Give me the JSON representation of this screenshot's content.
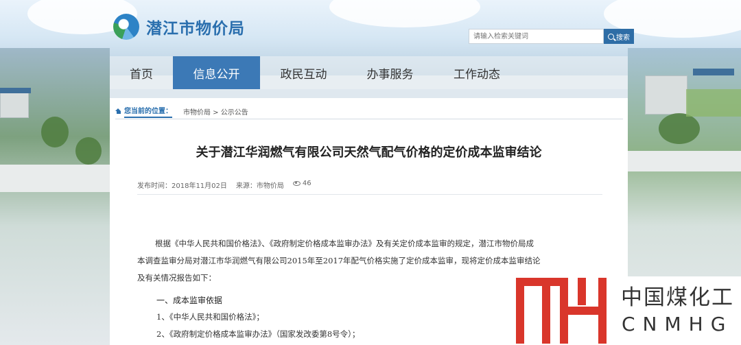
{
  "site": {
    "name": "潜江市物价局"
  },
  "search": {
    "placeholder": "请输入检索关键词",
    "button_label": "搜索"
  },
  "nav": {
    "items": [
      {
        "label": "首页",
        "active": false
      },
      {
        "label": "信息公开",
        "active": true
      },
      {
        "label": "政民互动",
        "active": false
      },
      {
        "label": "办事服务",
        "active": false
      },
      {
        "label": "工作动态",
        "active": false
      }
    ]
  },
  "breadcrumb": {
    "label": "您当前的位置：",
    "path": "市物价局 > 公示公告"
  },
  "article": {
    "title": "关于潜江华润燃气有限公司天然气配气价格的定价成本监审结论",
    "publish_time": "发布时间：2018年11月02日",
    "source": "来源：市物价局",
    "views": "46",
    "paragraph_lines": [
      "根据《中华人民共和国价格法》、《政府制定价格成本监审办法》及有关定价成本监审的规定，潜江市物价局成",
      "本调查监审分局对潜江市华润燃气有限公司2015年至2017年配气价格实施了定价成本监审，现将定价成本监审结论",
      "及有关情况报告如下："
    ],
    "heading1": "一、成本监审依据",
    "list": [
      "1、《中华人民共和国价格法》；",
      "2、《政府制定价格成本监审办法》（国家发改委第8号令）；"
    ]
  },
  "watermark": {
    "cn": "中国煤化工",
    "en": "CNMHG",
    "color": "#d9362b"
  },
  "colors": {
    "nav_active": "#3c79b6",
    "link": "#2a6fae"
  }
}
